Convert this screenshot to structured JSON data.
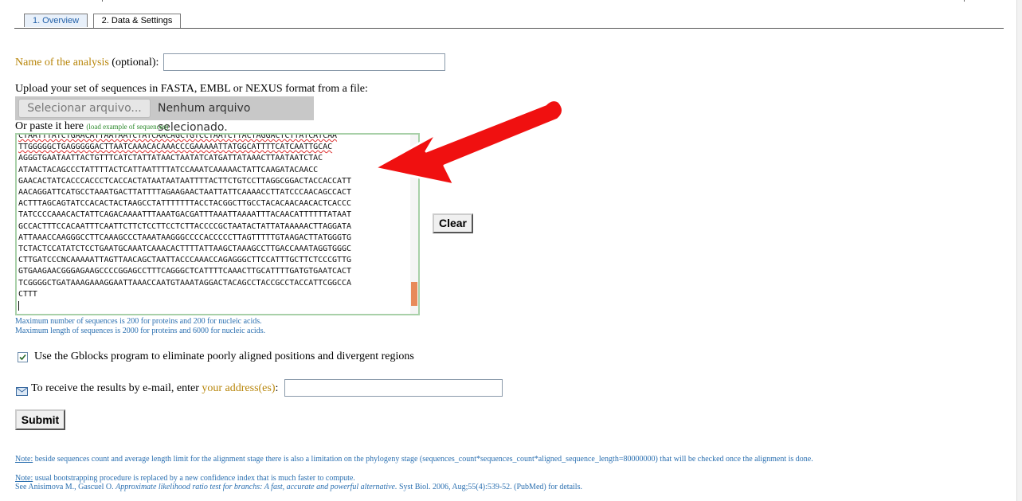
{
  "tabs": [
    {
      "label": "1. Overview"
    },
    {
      "label": "2. Data & Settings"
    }
  ],
  "analysis": {
    "label_orange": "Name of the analysis",
    "label_rest": "(optional):",
    "value": ""
  },
  "upload": {
    "label": "Upload your set of sequences in FASTA, EMBL or NEXUS format from a file:",
    "button": "Selecionar arquivo...",
    "status": "Nenhum arquivo selecionado."
  },
  "paste": {
    "label": "Or paste it here",
    "example_link": "(load example of sequences)",
    "lines": [
      "CTAATTTATCTGAACATTAATAATCTATCAACAGCTGTCCTAATCTTACTAGGACTCTTATCATCAA",
      "TTGGGGGCTGAGGGGGACTTAATCAAACACAAACCCGAAAAATTATGGCATTTTCATCAATTGCAC",
      "AGGGTGAATAATTACTGTTTCATCTATTATAACTAATATCATGATTATAAACTTAATAATCTAC",
      "ATAACTACAGCCCTATTTTACTCATTAATTTTATCCAAATCAAAAACTATTCAAGATACAACC",
      "GAACACTATCACCCACCCTCACCACTATAATAATAATTTTACTTCTGTCCTTAGGCGGACTACCACCATT",
      "AACAGGATTCATGCCTAAATGACTTATTTTAGAAGAACTAATTATTCAAAACCTTATCCCAACAGCCACT",
      "ACTTTAGCAGTATCCACACTACTAAGCCTATTTTTTTACCTACGGCTTGCCTACACAACAACACTCACCC",
      "TATCCCCAAACACTATTCAGACAAAATTTAAATGACGATTTAAATTAAAATTTACAACATTTTTTATAAT",
      "GCCACTTTCCACAATTTCAATTCTTCTCCTTCCTCTTACCCCGCTAATACTATTATAAAAACTTAGGATA",
      "ATTAAACCAAGGGCCTTCAAAGCCCTAAATAAGGGCCCCACCCCCTTAGTTTTTGTAAGACTTATGGGTG",
      "TCTACTCCATATCTCCTGAATGCAAATCAAACACTTTTATTAAGCTAAAGCCTTGACCAAATAGGTGGGC",
      "CTTGATCCCNCAAAAATTAGTTAACAGCTAATTACCCAAACCAGAGGGCTTCCATTTGCTTCTCCCGTTG",
      "GTGAAGAACGGGAGAAGCCCCGGAGCCTTTCAGGGCTCATTTTCAAACTTGCATTTTGATGTGAATCACT",
      "TCGGGGCTGATAAAGAAAGGAATTAAACCAATGTAAATAGGACTACAGCCTACCGCCTACCATTCGGCCA",
      "CTTT"
    ],
    "clear_button": "Clear"
  },
  "limits": {
    "line1": "Maximum number of sequences is 200 for proteins and 200 for nucleic acids.",
    "line2": "Maximum length of sequences is 2000 for proteins and 6000 for nucleic acids."
  },
  "gblocks": {
    "checked": true,
    "label": "Use the Gblocks program to eliminate poorly aligned positions and divergent regions"
  },
  "email": {
    "label_start": "To receive the results by e-mail, enter",
    "label_link": "your address(es)",
    "label_end": ":",
    "value": ""
  },
  "submit": "Submit",
  "notes": {
    "note1_prefix": "Note:",
    "note1_text": " beside sequences count and average length limit for the alignment stage there is also a limitation on the phylogeny stage (sequences_count*sequences_count*aligned_sequence_length=80000000) that will be checked once the alignment is done.",
    "note2_prefix": "Note:",
    "note2_text": " usual bootstrapping procedure is replaced by a new confidence index that is much faster to compute.",
    "note3_a": "See Anisimova M., Gascuel O. ",
    "note3_italic": "Approximate likelihood ratio test for branchs: A fast, accurate and powerful alternative.",
    "note3_b": " Syst Biol. 2006, Aug;55(4):539-52. (PubMed) for details."
  },
  "colors": {
    "arrow": "#f01010",
    "tab_link": "#2260a8",
    "accent_orange": "#b8860b",
    "note_blue": "#2a6fb0"
  }
}
